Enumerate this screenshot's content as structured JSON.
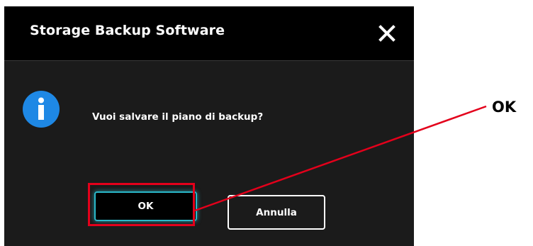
{
  "dialog": {
    "title": "Storage Backup Software",
    "message": "Vuoi salvare il piano di backup?",
    "icon": "info-icon",
    "close_icon": "close-icon"
  },
  "buttons": {
    "ok_label": "OK",
    "cancel_label": "Annulla"
  },
  "annotation": {
    "callout_label": "OK",
    "highlight_color": "#e3001b"
  },
  "colors": {
    "dialog_background": "#1b1b1b",
    "titlebar_background": "#000000",
    "info_blue": "#1e88e5",
    "focus_glow": "#2ab7c9"
  }
}
